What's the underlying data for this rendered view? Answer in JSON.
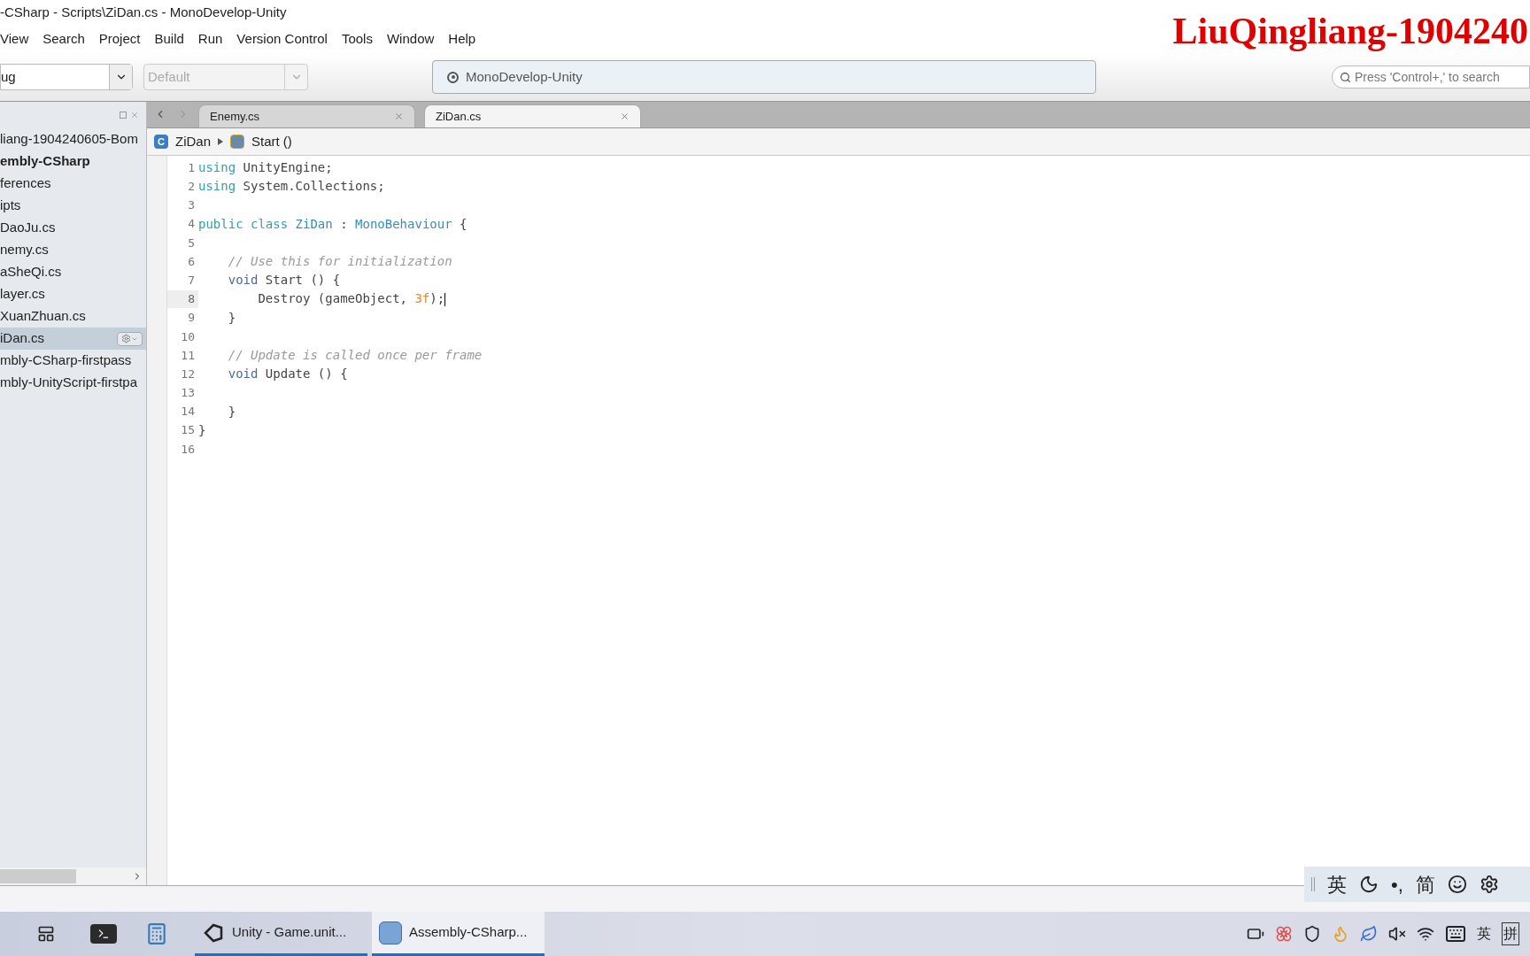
{
  "window": {
    "title": "-CSharp - Scripts\\ZiDan.cs - MonoDevelop-Unity"
  },
  "overlay_caption": "LiuQingliang-1904240",
  "menu": [
    "View",
    "Search",
    "Project",
    "Build",
    "Run",
    "Version Control",
    "Tools",
    "Window",
    "Help"
  ],
  "toolbar": {
    "configuration": "ug",
    "platform": {
      "value": "Default",
      "disabled": true
    },
    "status": "MonoDevelop-Unity",
    "search": {
      "placeholder": "Press 'Control+,' to search"
    }
  },
  "solution_tree": [
    {
      "label": "liang-1904240605-Bom",
      "bold": false,
      "selected": false,
      "children": [
        {
          "label": "embly-CSharp",
          "bold": true,
          "selected": false,
          "children": [
            {
              "label": "ferences",
              "bold": false,
              "selected": false
            },
            {
              "label": "ipts",
              "bold": false,
              "selected": false,
              "children": [
                {
                  "label": "DaoJu.cs",
                  "bold": false,
                  "selected": false
                },
                {
                  "label": "nemy.cs",
                  "bold": false,
                  "selected": false
                },
                {
                  "label": "aSheQi.cs",
                  "bold": false,
                  "selected": false
                },
                {
                  "label": "layer.cs",
                  "bold": false,
                  "selected": false
                },
                {
                  "label": "XuanZhuan.cs",
                  "bold": false,
                  "selected": false
                },
                {
                  "label": "iDan.cs",
                  "bold": false,
                  "selected": true
                }
              ]
            }
          ]
        },
        {
          "label": "mbly-CSharp-firstpass",
          "bold": false,
          "selected": false
        },
        {
          "label": "mbly-UnityScript-firstpa",
          "bold": false,
          "selected": false
        }
      ]
    }
  ],
  "tabs": [
    {
      "label": "Enemy.cs",
      "selected": false
    },
    {
      "label": "ZiDan.cs",
      "selected": true
    }
  ],
  "breadcrumb": [
    {
      "label": "ZiDan",
      "kind": "class",
      "icon_letter": "C"
    },
    {
      "label": "Start ()",
      "kind": "method"
    }
  ],
  "code": [
    {
      "number": "1",
      "current": false,
      "tokens": [
        {
          "kind": "keyword",
          "text": "using"
        },
        {
          "kind": "plain",
          "text": " UnityEngine;"
        }
      ]
    },
    {
      "number": "2",
      "current": false,
      "tokens": [
        {
          "kind": "keyword",
          "text": "using"
        },
        {
          "kind": "plain",
          "text": " System.Collections;"
        }
      ]
    },
    {
      "number": "3",
      "current": false
    },
    {
      "number": "4",
      "current": false,
      "tokens": [
        {
          "kind": "keyword",
          "text": "public class "
        },
        {
          "kind": "type",
          "text": "ZiDan"
        },
        {
          "kind": "plain",
          "text": " : "
        },
        {
          "kind": "type",
          "text": "MonoBehaviour"
        },
        {
          "kind": "plain",
          "text": " {"
        }
      ]
    },
    {
      "number": "5",
      "current": false
    },
    {
      "number": "6",
      "current": false,
      "tokens": [
        {
          "kind": "comment",
          "text": "    // Use this for initialization"
        }
      ]
    },
    {
      "number": "7",
      "current": false,
      "tokens": [
        {
          "kind": "builtin",
          "text": "    void"
        },
        {
          "kind": "plain",
          "text": " Start () {"
        }
      ]
    },
    {
      "number": "8",
      "current": true,
      "tokens": [
        {
          "kind": "plain",
          "text": "        Destroy (gameObject, "
        },
        {
          "kind": "number",
          "text": "3f"
        },
        {
          "kind": "plain",
          "text": ");"
        }
      ]
    },
    {
      "number": "9",
      "current": false,
      "tokens": [
        {
          "kind": "plain",
          "text": "    }"
        }
      ]
    },
    {
      "number": "10",
      "current": false
    },
    {
      "number": "11",
      "current": false,
      "tokens": [
        {
          "kind": "comment",
          "text": "    // Update is called once per frame"
        }
      ]
    },
    {
      "number": "12",
      "current": false,
      "tokens": [
        {
          "kind": "builtin",
          "text": "    void"
        },
        {
          "kind": "plain",
          "text": " Update () {"
        }
      ]
    },
    {
      "number": "13",
      "current": false
    },
    {
      "number": "14",
      "current": false,
      "tokens": [
        {
          "kind": "plain",
          "text": "    }"
        }
      ]
    },
    {
      "number": "15",
      "current": false,
      "tokens": [
        {
          "kind": "plain",
          "text": "}"
        }
      ]
    },
    {
      "number": "16",
      "current": false
    }
  ],
  "ime_bar": [
    {
      "kind": "text",
      "text": "英"
    },
    {
      "kind": "moon"
    },
    {
      "kind": "text",
      "text": "•,"
    },
    {
      "kind": "text",
      "text": "简"
    },
    {
      "kind": "smile"
    },
    {
      "kind": "gear"
    }
  ],
  "taskbar": {
    "apps": [
      {
        "label": "Unity - Game.unit...",
        "kind": "unity",
        "selected": false
      },
      {
        "label": "Assembly-CSharp...",
        "kind": "monodevelop",
        "selected": true
      }
    ],
    "tray_texts": [
      "英",
      "拼"
    ]
  }
}
